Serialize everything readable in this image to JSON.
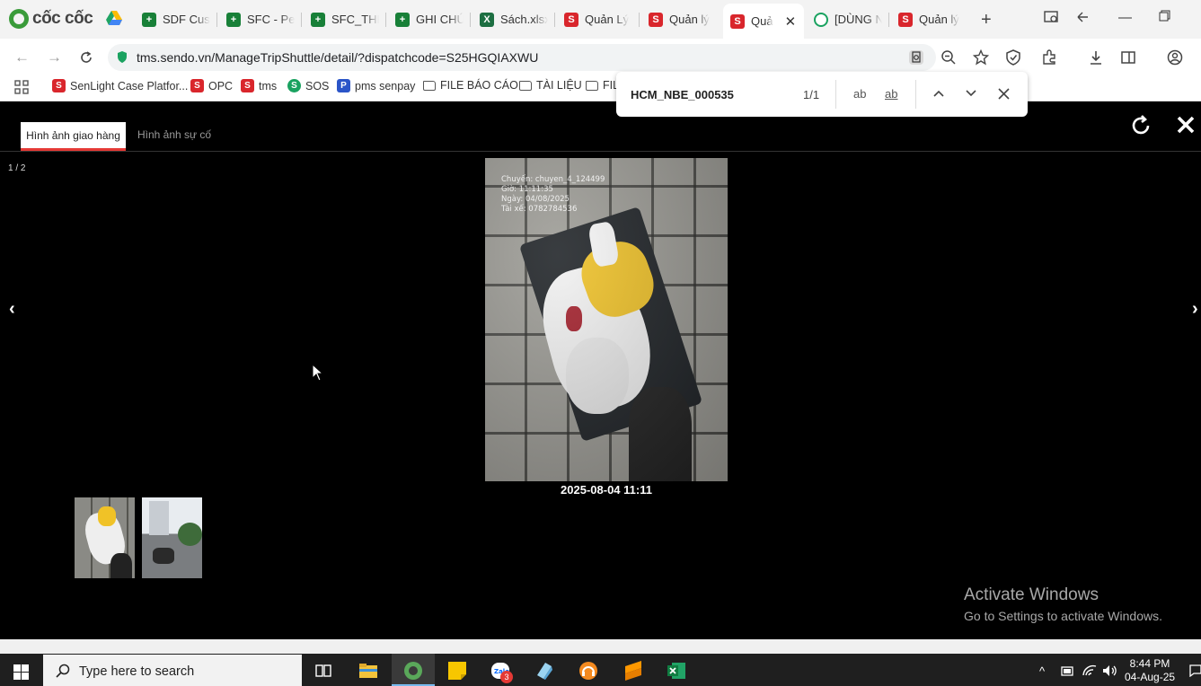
{
  "browser": {
    "logo_text": "cốc cốc",
    "tabs": [
      {
        "title": "SDF Cust",
        "fav": "sheets-icon"
      },
      {
        "title": "SFC - Per",
        "fav": "sheets-icon"
      },
      {
        "title": "SFC_THE",
        "fav": "sheets-icon"
      },
      {
        "title": "GHI CHÚ",
        "fav": "sheets-icon"
      },
      {
        "title": "Sách.xlsx",
        "fav": "excel-icon"
      },
      {
        "title": "Quản Lý",
        "fav": "sendo-icon"
      },
      {
        "title": "Quản lý",
        "fav": "sendo-icon"
      },
      {
        "title": "Quả",
        "fav": "sendo-icon",
        "active": true
      },
      {
        "title": "[DÙNG N",
        "fav": "coccoc-icon"
      },
      {
        "title": "Quản lý",
        "fav": "sendo-icon"
      }
    ],
    "url": "tms.sendo.vn/ManageTripShuttle/detail/?dispatchcode=S25HGQIAXWU",
    "bookmarks": [
      {
        "label": "SenLight Case Platfor...",
        "icon": "sendo-icon"
      },
      {
        "label": "OPC",
        "icon": "sendo-icon"
      },
      {
        "label": "tms",
        "icon": "sendo-icon"
      },
      {
        "label": "SOS",
        "icon": "coccoc-icon"
      },
      {
        "label": "pms senpay",
        "icon": "p-icon"
      },
      {
        "label": "FILE BÁO CÁO",
        "icon": "folder-icon"
      },
      {
        "label": "TÀI LIỆU",
        "icon": "folder-icon"
      },
      {
        "label": "FIL",
        "icon": "folder-icon"
      }
    ]
  },
  "find": {
    "query": "HCM_NBE_000535",
    "count": "1/1",
    "match_case": "ab",
    "whole_word": "ab"
  },
  "viewer": {
    "tabs": [
      "Hình ảnh giao hàng",
      "Hình ảnh sự cố"
    ],
    "counter": "1 / 2",
    "watermark": [
      "Chuyến: chuyen_4_124499",
      "Giờ: 11:11:35",
      "Ngày: 04/08/2025",
      "Tài xế: 0782784536"
    ],
    "timestamp": "2025-08-04 11:11",
    "prev": "‹",
    "next": "›"
  },
  "windows_notice": {
    "title": "Activate Windows",
    "subtitle": "Go to Settings to activate Windows."
  },
  "taskbar": {
    "search_placeholder": "Type here to search",
    "time": "8:44 PM",
    "date": "04-Aug-25",
    "zalo_badge": "3"
  },
  "colors": {
    "accent_red": "#e53935",
    "sheets_green": "#188038",
    "excel_green": "#1d6f42",
    "sendo_red": "#d9262c"
  }
}
